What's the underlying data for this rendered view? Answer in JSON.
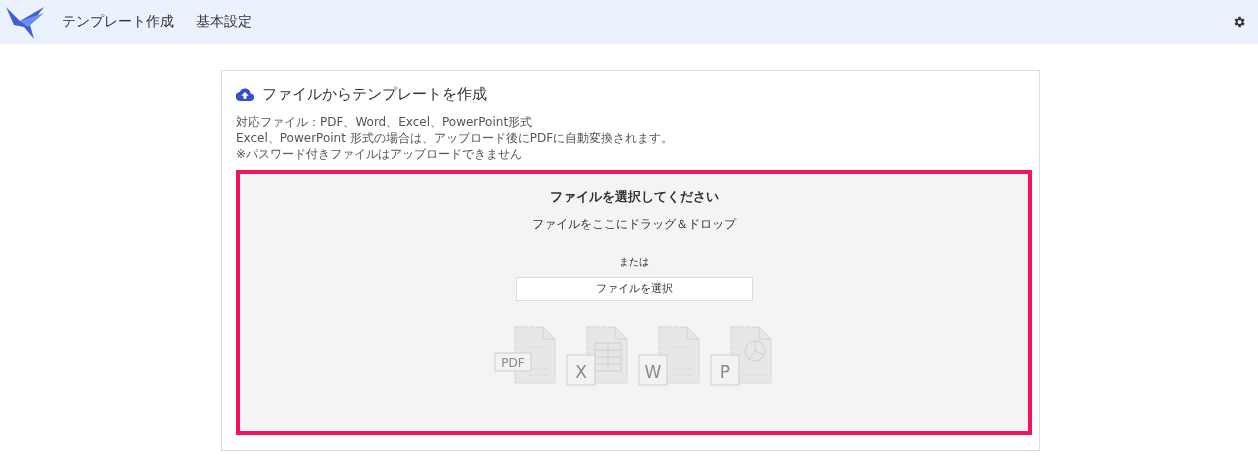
{
  "header": {
    "nav": [
      {
        "label": "テンプレート作成"
      },
      {
        "label": "基本設定"
      }
    ]
  },
  "card": {
    "title": "ファイルからテンプレートを作成",
    "notes": [
      "対応ファイル：PDF、Word、Excel、PowerPoint形式",
      "Excel、PowerPoint 形式の場合は、アップロード後にPDFに自動変換されます。",
      "※パスワード付きファイルはアップロードできません"
    ],
    "dropzone": {
      "highlighted": true,
      "heading": "ファイルを選択してください",
      "hint": "ファイルをここにドラッグ＆ドロップ",
      "or": "または",
      "button": "ファイルを選択",
      "file_types": [
        {
          "kind": "pdf",
          "label": "PDF"
        },
        {
          "kind": "excel",
          "label": "X"
        },
        {
          "kind": "word",
          "label": "W"
        },
        {
          "kind": "powerpoint",
          "label": "P"
        }
      ]
    }
  }
}
